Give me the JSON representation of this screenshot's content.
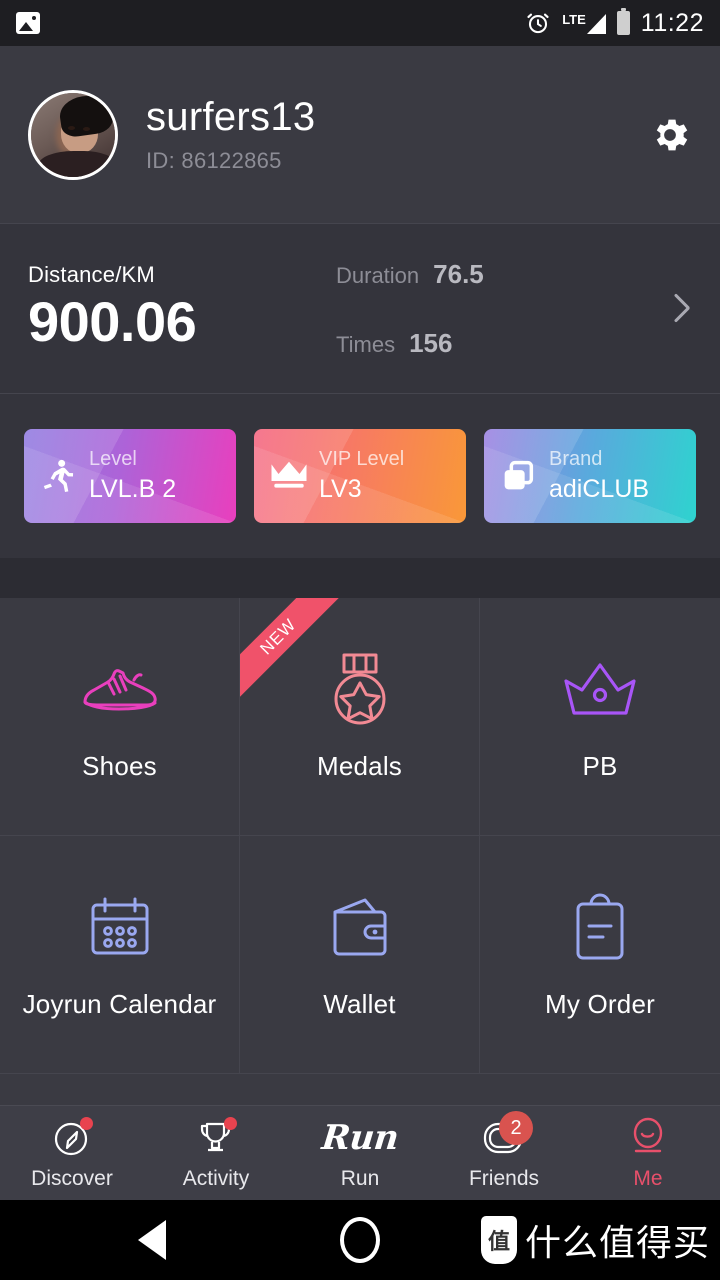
{
  "statusbar": {
    "time": "11:22",
    "network": "LTE",
    "icons": [
      "image-icon",
      "alarm-icon",
      "lte-signal-icon",
      "battery-icon"
    ]
  },
  "profile": {
    "username": "surfers13",
    "id_label": "ID: 86122865",
    "settings_icon": "gear-icon",
    "avatar_icon": "avatar"
  },
  "stats": {
    "distance_label": "Distance/KM",
    "distance_value": "900.06",
    "duration_label": "Duration",
    "duration_value": "76.5",
    "times_label": "Times",
    "times_value": "156",
    "chevron_icon": "chevron-right-icon"
  },
  "cards": [
    {
      "label": "Level",
      "value": "LVL.B 2",
      "icon": "runner-icon",
      "color_from": "#8f7ae0",
      "color_to": "#e93fbd"
    },
    {
      "label": "VIP Level",
      "value": "LV3",
      "icon": "crown-icon",
      "color_from": "#f4637f",
      "color_to": "#f99838"
    },
    {
      "label": "Brand",
      "value": "adiCLUB",
      "icon": "cards-stack-icon",
      "color_from": "#9b7fe0",
      "color_to": "#2ed3cf"
    }
  ],
  "grid": [
    {
      "label": "Shoes",
      "icon": "sneaker-icon",
      "color": "#e93fbd",
      "badge": ""
    },
    {
      "label": "Medals",
      "icon": "medal-icon",
      "color": "#f28a94",
      "badge": "NEW"
    },
    {
      "label": "PB",
      "icon": "crown-outline-icon",
      "color": "#a855f7",
      "badge": ""
    },
    {
      "label": "Joyrun Calendar",
      "icon": "calendar-icon",
      "color": "#9aa8f0",
      "badge": ""
    },
    {
      "label": "Wallet",
      "icon": "wallet-icon",
      "color": "#9aa8f0",
      "badge": ""
    },
    {
      "label": "My Order",
      "icon": "clipboard-icon",
      "color": "#9aa8f0",
      "badge": ""
    }
  ],
  "bottomnav": [
    {
      "label": "Discover",
      "icon": "compass-icon",
      "dot": true,
      "badge": "",
      "active": false
    },
    {
      "label": "Activity",
      "icon": "trophy-icon",
      "dot": true,
      "badge": "",
      "active": false
    },
    {
      "label": "Run",
      "icon": "run-script-logo",
      "logo_text": "Run",
      "dot": false,
      "badge": "",
      "active": false
    },
    {
      "label": "Friends",
      "icon": "friends-icon",
      "dot": false,
      "badge": "2",
      "active": false
    },
    {
      "label": "Me",
      "icon": "profile-face-icon",
      "dot": false,
      "badge": "",
      "active": true
    }
  ],
  "androidnav": {
    "back_icon": "back-triangle-icon",
    "home_icon": "home-circle-icon",
    "watermark_text": "什么值得买",
    "watermark_logo": "值"
  },
  "theme": {
    "bg": "#34343c",
    "panel": "#3a3a42",
    "accent": "#e8506b",
    "badge_red": "#d9534f"
  }
}
